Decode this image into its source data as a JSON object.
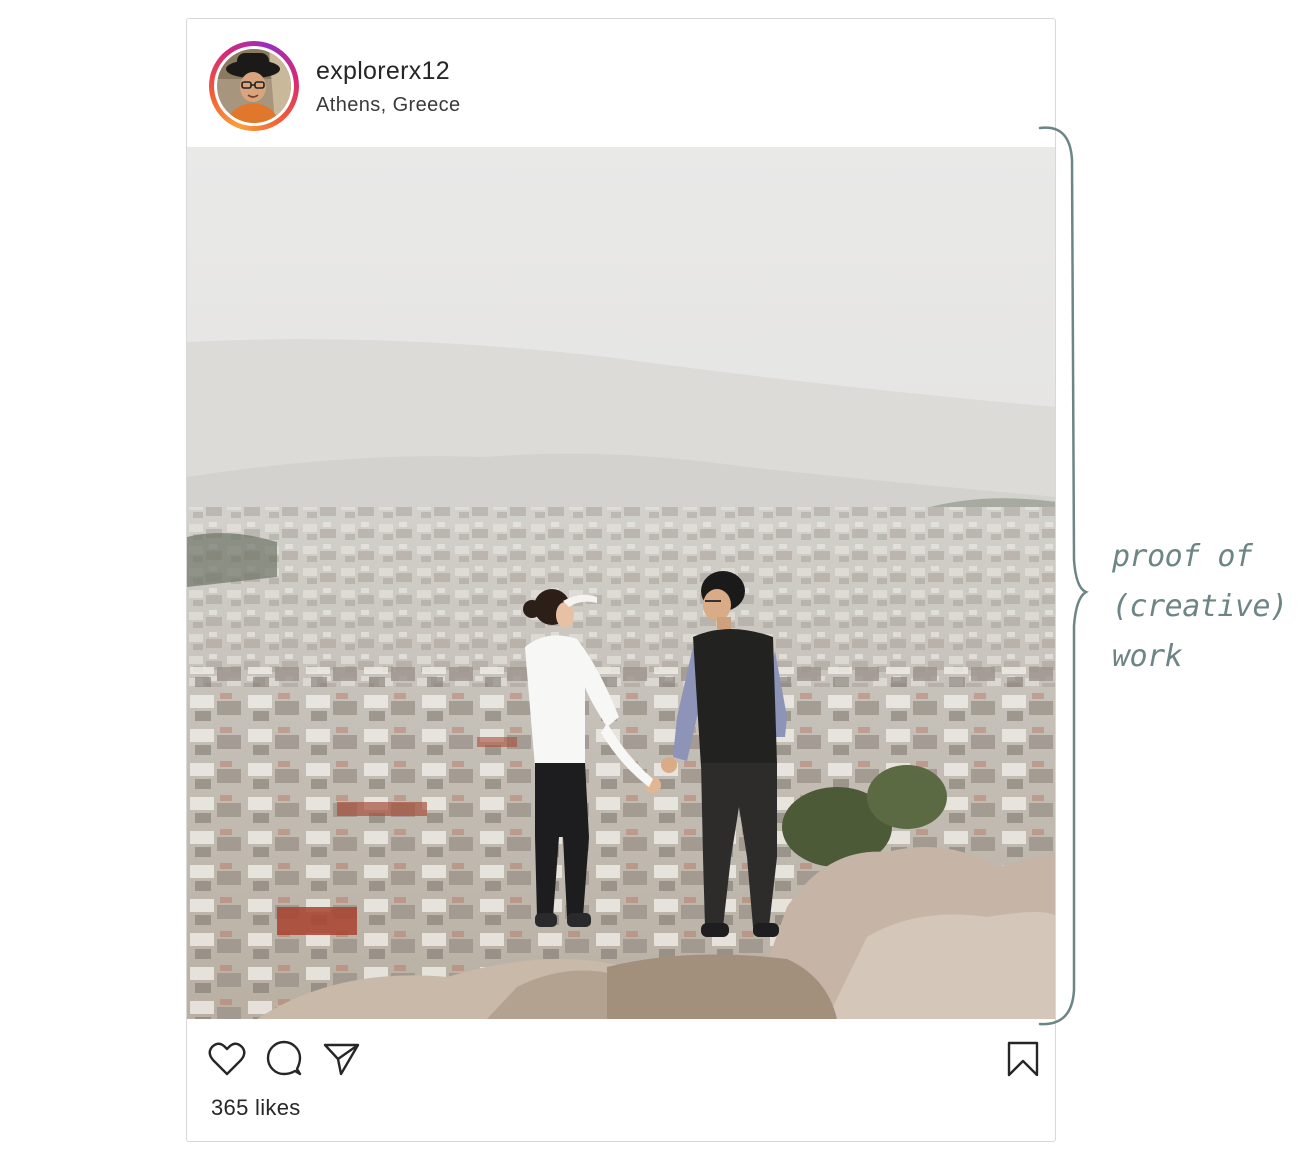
{
  "post": {
    "username": "explorerx12",
    "location": "Athens, Greece",
    "likes": "365 likes",
    "actions": {
      "like_icon": "heart-icon",
      "comment_icon": "speech-bubble-icon",
      "share_icon": "paper-plane-icon",
      "save_icon": "bookmark-icon"
    },
    "avatar_ring_colors": [
      "#f9a13a",
      "#f15b36",
      "#d62976",
      "#962fbf"
    ]
  },
  "annotation": {
    "lines": [
      "proof of",
      "(creative)",
      "work"
    ],
    "color": "#6d8585"
  }
}
